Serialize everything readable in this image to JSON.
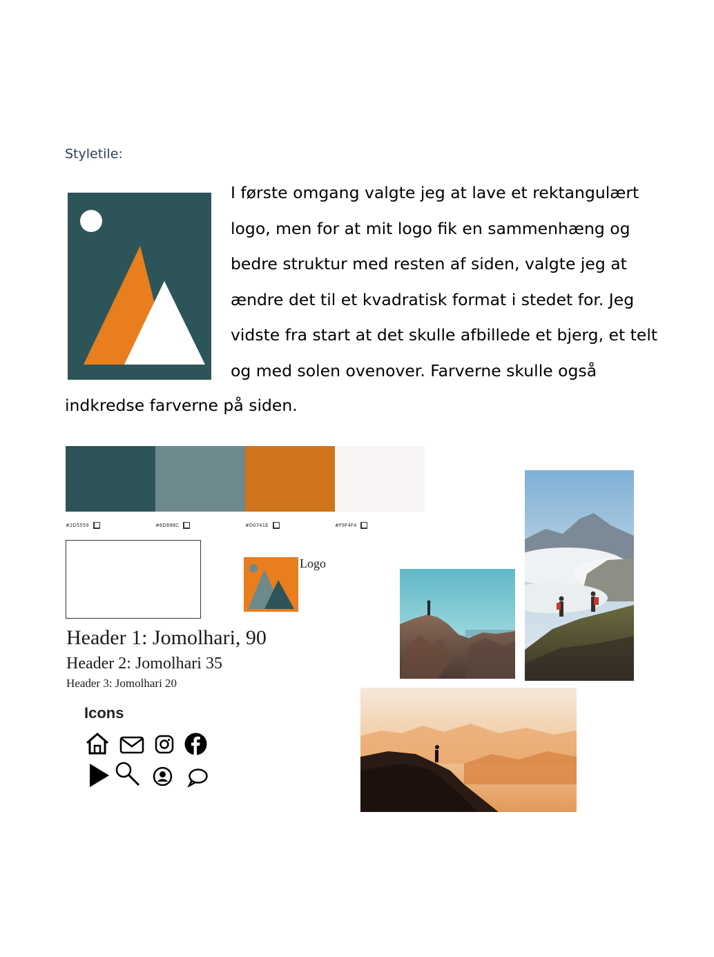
{
  "heading": "Styletile:",
  "intro_lines": [
    "I første omgang valgte jeg at lave et rektangulært",
    "logo, men for at mit logo fik en sammenhæng og",
    "bedre struktur med resten af siden, valgte jeg at",
    "ændre det til et kvadratisk format i stedet for. Jeg",
    "vidste fra start at det skulle afbillede et bjerg, et telt",
    "og med solen ovenover. Farverne skulle også",
    "indkredse farverne på siden."
  ],
  "palette": [
    {
      "hex": "#2D5559",
      "label": "#2D5559"
    },
    {
      "hex": "#6D898C",
      "label": "#6D898C"
    },
    {
      "hex": "#D0741E",
      "label": "#D0741E"
    },
    {
      "hex": "#F9F4F4",
      "label": "#F9F4F4"
    }
  ],
  "logo_label": "Logo",
  "typography": {
    "h1": "Header 1: Jomolhari, 90",
    "h2": "Header 2: Jomolhari 35",
    "h3": "Header 3: Jomolhari 20"
  },
  "icons_title": "Icons",
  "icons": [
    "home-icon",
    "mail-icon",
    "instagram-icon",
    "facebook-icon",
    "play-icon",
    "search-icon",
    "user-icon",
    "chat-icon"
  ],
  "colors": {
    "dark_teal": "#2D5559",
    "orange": "#E87E1E",
    "white": "#FFFFFF"
  }
}
